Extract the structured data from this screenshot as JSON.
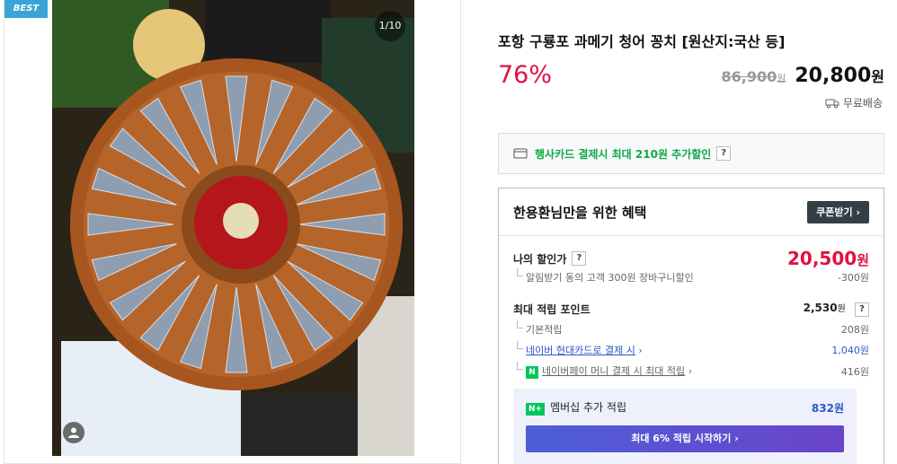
{
  "gallery": {
    "badge": "BEST",
    "counter": "1/10"
  },
  "product": {
    "title": "포항 구룡포 과메기 청어 꽁치 [원산지:국산 등]",
    "discount": "76%",
    "original_price": "86,900",
    "original_unit": "원",
    "sale_price": "20,800",
    "sale_unit": "원",
    "shipping": "무료배송"
  },
  "card_promo": {
    "text": "행사카드 결제시 최대 210원 추가할인",
    "help": "?"
  },
  "benefit": {
    "title": "한용환님만을 위한 혜택",
    "coupon_button": "쿠폰받기",
    "my_price_label": "나의 할인가",
    "my_price_value": "20,500",
    "my_price_unit": "원",
    "my_price_detail_label": "알림받기 동의 고객 300원 장바구니할인",
    "my_price_detail_value": "-300원",
    "points_label": "최대 적립 포인트",
    "points_value": "2,530",
    "points_unit": "원",
    "base_label": "기본적립",
    "base_value": "208원",
    "card_label": "네이버 현대카드로 결제 시",
    "card_value": "1,040원",
    "npay_label": "네이버페이 머니 결제 시 최대 적립",
    "npay_value": "416원",
    "member_label": "멤버십 추가 적립",
    "member_value": "832원",
    "member_button": "최대 6% 적립 시작하기"
  },
  "icons": {
    "card": "credit-card-icon",
    "truck": "truck-icon",
    "chevron": "chevron-right-icon",
    "npay": "N",
    "nplus": "N+"
  },
  "colors": {
    "accent_red": "#e0113f",
    "naver_green": "#03c75a",
    "badge_blue": "#3aa4d8",
    "link_blue": "#2e56c7"
  }
}
